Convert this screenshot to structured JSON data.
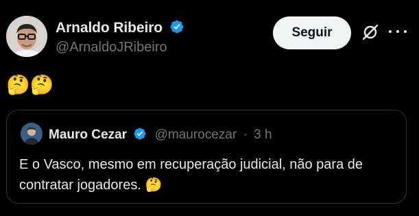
{
  "author": {
    "name": "Arnaldo Ribeiro",
    "handle": "@ArnaldoJRibeiro",
    "verified": true
  },
  "actions": {
    "follow_label": "Seguir",
    "grok_icon": "grok-icon",
    "more_icon": "more-icon"
  },
  "tweet": {
    "text": "🤔🤔"
  },
  "quoted": {
    "name": "Mauro Cezar",
    "handle": "@maurocezar",
    "separator": "·",
    "time": "3 h",
    "text": "E o Vasco, mesmo em recuperação judicial, não para de contratar jogadores. 🤔"
  },
  "colors": {
    "background": "#000000",
    "text": "#e7e9ea",
    "muted": "#71767b",
    "verified_blue": "#1d9bf0",
    "border": "#2f3336",
    "button_bg": "#eff3f4"
  }
}
